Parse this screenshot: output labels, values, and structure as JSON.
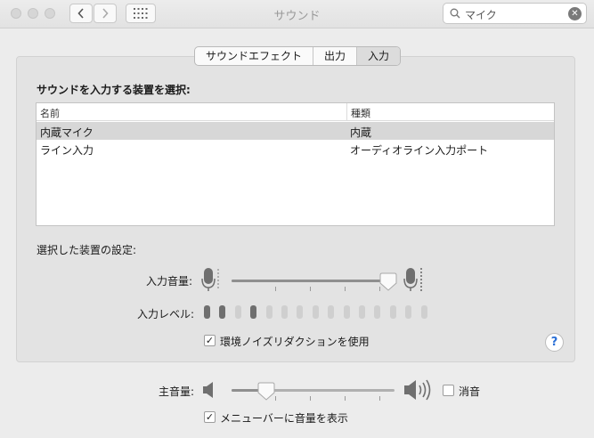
{
  "window": {
    "title": "サウンド"
  },
  "search": {
    "query": "マイク",
    "clear_icon": "clear-icon"
  },
  "tabs": [
    {
      "label": "サウンドエフェクト",
      "selected": false
    },
    {
      "label": "出力",
      "selected": false
    },
    {
      "label": "入力",
      "selected": true
    }
  ],
  "input": {
    "section_title": "サウンドを入力する装置を選択:",
    "table": {
      "columns": [
        "名前",
        "種類"
      ],
      "rows": [
        {
          "name": "内蔵マイク",
          "type": "内蔵",
          "selected": true
        },
        {
          "name": "ライン入力",
          "type": "オーディオライン入力ポート",
          "selected": false
        }
      ]
    },
    "settings_title": "選択した装置の設定:",
    "volume_label": "入力音量:",
    "volume_fraction": 0.94,
    "level_label": "入力レベル:",
    "level_active_count": 4,
    "level_total": 15,
    "noise_reduction": {
      "label": "環境ノイズリダクションを使用",
      "checked": true
    }
  },
  "output": {
    "volume_label": "主音量:",
    "volume_fraction": 0.2,
    "mute": {
      "label": "消音",
      "checked": false
    },
    "show_in_menubar": {
      "label": "メニューバーに音量を表示",
      "checked": true
    }
  },
  "help": {
    "label": "?"
  }
}
